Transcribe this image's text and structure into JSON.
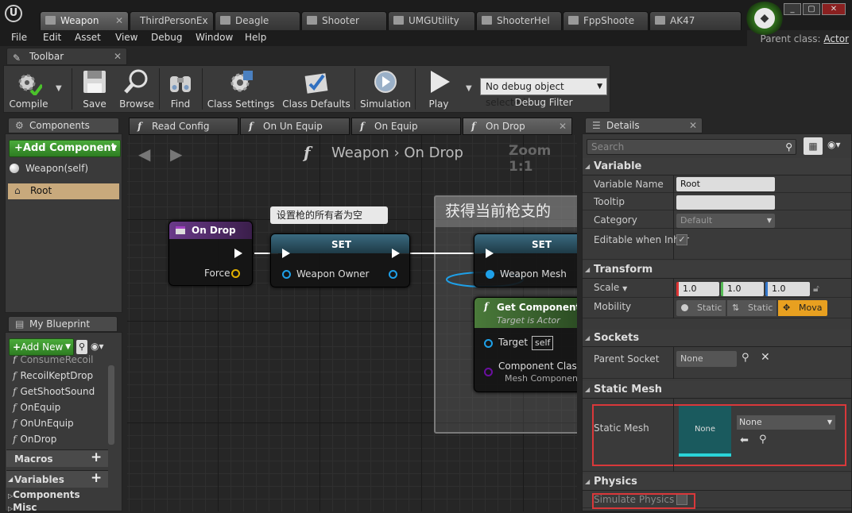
{
  "window": {
    "tabs": [
      "Weapon",
      "ThirdPersonEx",
      "Deagle",
      "Shooter",
      "UMGUtility",
      "ShooterHel",
      "FppShoote",
      "AK47"
    ],
    "active_tab": "Weapon",
    "min": "_",
    "max": "▢",
    "close": "✕"
  },
  "menu": [
    "File",
    "Edit",
    "Asset",
    "View",
    "Debug",
    "Window",
    "Help"
  ],
  "parent_class": {
    "label": "Parent class:",
    "value": "Actor"
  },
  "toolbar": {
    "tab_label": "Toolbar",
    "buttons": [
      "Compile",
      "Save",
      "Browse",
      "Find",
      "Class Settings",
      "Class Defaults",
      "Simulation",
      "Play"
    ],
    "debug_select": "No debug object selected",
    "debug_filter": "Debug Filter"
  },
  "components": {
    "tab_label": "Components",
    "add_button": "+Add Component",
    "items": [
      "Weapon(self)",
      "Root"
    ]
  },
  "my_blueprint": {
    "tab_label": "My Blueprint",
    "add_button": "Add New",
    "partial_item": "ConsumeRecoil",
    "functions": [
      "RecoilKeptDrop",
      "GetShootSound",
      "OnEquip",
      "OnUnEquip",
      "OnDrop"
    ],
    "sections": [
      "Macros",
      "Variables"
    ],
    "sub_sections": [
      "Components",
      "Misc"
    ]
  },
  "editor_tabs": [
    "Read Config",
    "On Un Equip",
    "On Equip",
    "On Drop"
  ],
  "graph": {
    "breadcrumb_root": "Weapon",
    "breadcrumb_sep": "›",
    "breadcrumb_leaf": "On Drop",
    "zoom": "Zoom 1:1",
    "comment_bubble": "设置枪的所有者为空",
    "comment_box_title": "获得当前枪支的",
    "nodes": {
      "on_drop": {
        "title": "On Drop",
        "pin": "Force"
      },
      "set1": {
        "title": "SET",
        "pin": "Weapon Owner"
      },
      "set2": {
        "title": "SET",
        "pin": "Weapon Mesh"
      },
      "get_component": {
        "title": "Get Component b",
        "subtitle": "Target is Actor",
        "target_label": "Target",
        "target_value": "self",
        "class_label": "Component Class",
        "class_value": "Mesh Componen"
      }
    }
  },
  "details": {
    "tab_label": "Details",
    "search_placeholder": "Search",
    "variable": {
      "header": "Variable",
      "name_label": "Variable Name",
      "name_value": "Root",
      "tooltip_label": "Tooltip",
      "tooltip_value": "",
      "category_label": "Category",
      "category_value": "Default",
      "editable_label": "Editable when Inher",
      "editable_checked": true
    },
    "transform": {
      "header": "Transform",
      "scale_label": "Scale",
      "scale": [
        "1.0",
        "1.0",
        "1.0"
      ],
      "mobility_label": "Mobility",
      "mobility": [
        "Static",
        "Static",
        "Mova"
      ]
    },
    "sockets": {
      "header": "Sockets",
      "parent_label": "Parent Socket",
      "parent_value": "None"
    },
    "static_mesh": {
      "header": "Static Mesh",
      "label": "Static Mesh",
      "thumb": "None",
      "value": "None"
    },
    "physics": {
      "header": "Physics",
      "simulate_label": "Simulate Physics",
      "simulate_checked": false
    }
  },
  "colors": {
    "highlight_red": "#d9383a",
    "exec_wire": "#ffffff",
    "object_pin": "#1ea0e8",
    "class_pin": "#6a0fa0",
    "force_pin": "#e0b000",
    "function_header": "#4d2a6a",
    "set_header": "#2e5a70",
    "pure_header": "#3a6a2e"
  }
}
